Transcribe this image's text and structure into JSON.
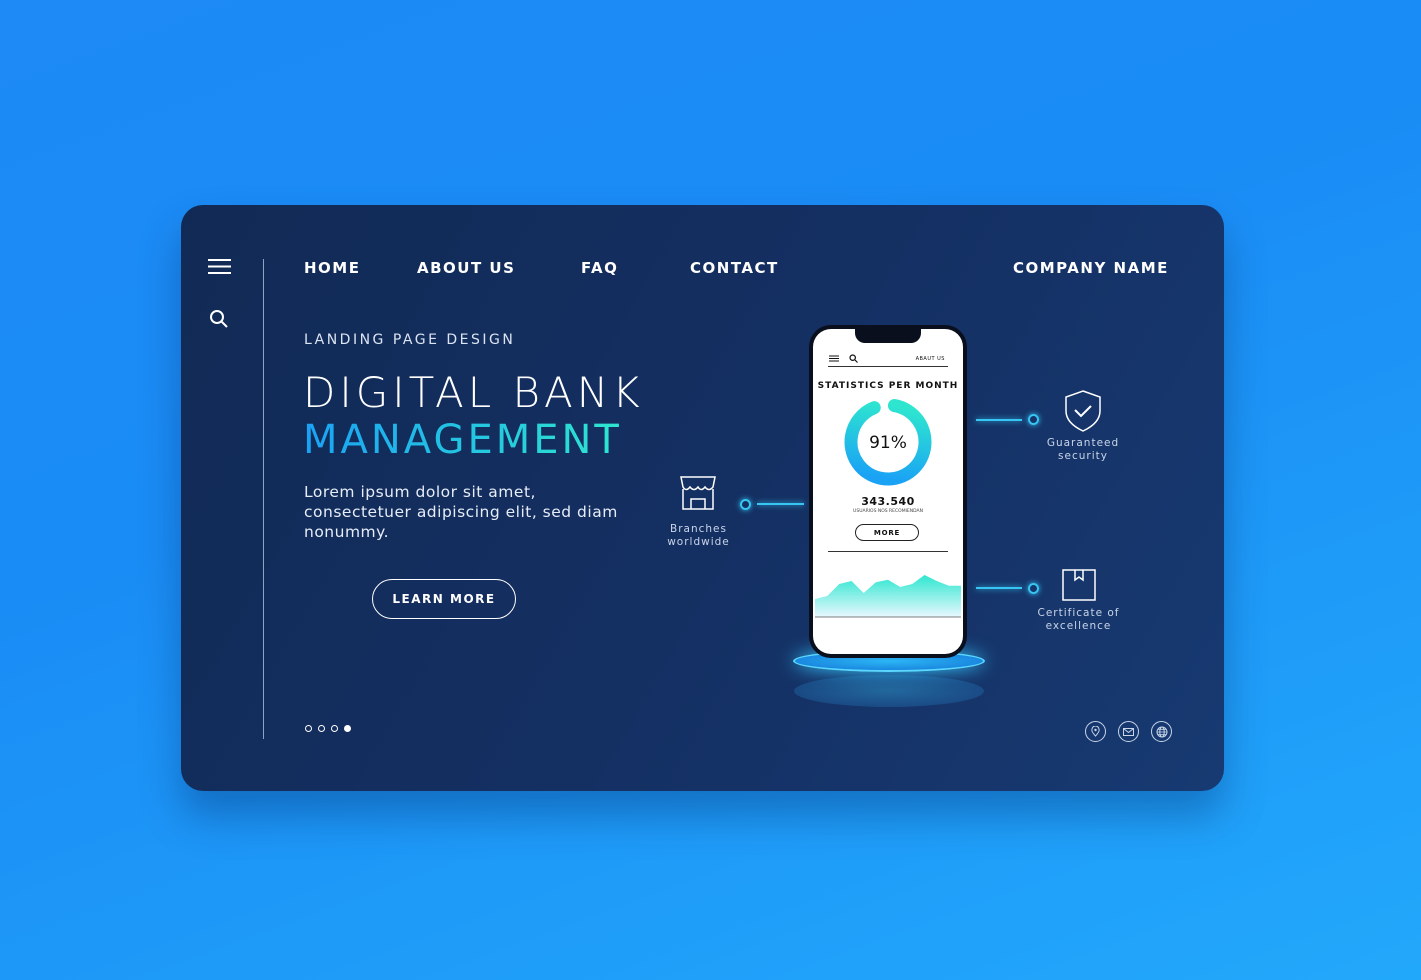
{
  "nav": {
    "items": [
      "HOME",
      "ABOUT US",
      "FAQ",
      "CONTACT"
    ],
    "company": "COMPANY NAME"
  },
  "hero": {
    "eyebrow": "LANDING PAGE DESIGN",
    "title_line1": "DIGITAL BANK",
    "title_line2": "MANAGEMENT",
    "body": "Lorem ipsum dolor sit amet, consectetuer adipiscing elit, sed diam nonummy.",
    "cta": "LEARN MORE"
  },
  "slider": {
    "count": 4,
    "active": 3
  },
  "features": [
    {
      "icon": "store-icon",
      "label": "Branches worldwide"
    },
    {
      "icon": "shield-check-icon",
      "label": "Guaranteed security"
    },
    {
      "icon": "box-icon",
      "label": "Certificate of excellence"
    }
  ],
  "phone": {
    "nav_link": "ABAUT US",
    "title": "STATISTICS PER MONTH",
    "percent_label": "91%",
    "percent": 91,
    "count": "343.540",
    "count_caption": "USUARIOS NOS RECOMIENDAN",
    "button": "MORE",
    "area_values": [
      30,
      35,
      55,
      60,
      40,
      58,
      62,
      50,
      55,
      70,
      60,
      52,
      52
    ]
  },
  "social": [
    "location-icon",
    "mail-icon",
    "globe-icon"
  ],
  "colors": {
    "accent_blue": "#1aa2f5",
    "accent_teal": "#2ee6cf",
    "card": "#142f62"
  }
}
